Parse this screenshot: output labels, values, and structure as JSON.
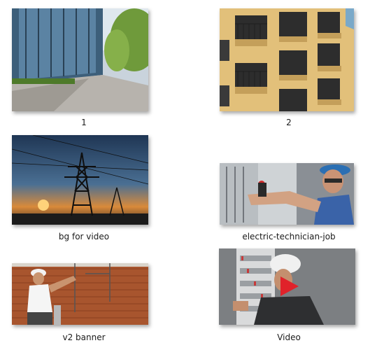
{
  "files": [
    {
      "name": "1",
      "type": "image",
      "thumb": "street-office-buildings"
    },
    {
      "name": "2",
      "type": "image",
      "thumb": "apartment-balconies"
    },
    {
      "name": "bg for video",
      "type": "image",
      "thumb": "power-pylon-sunset"
    },
    {
      "name": "electric-technician-job",
      "type": "image",
      "thumb": "technician-at-panel"
    },
    {
      "name": "v2 banner",
      "type": "image",
      "thumb": "worker-brick-wall"
    },
    {
      "name": "Video",
      "type": "video",
      "thumb": "technician-switchboard-video",
      "play_color": "#e0222a"
    }
  ]
}
